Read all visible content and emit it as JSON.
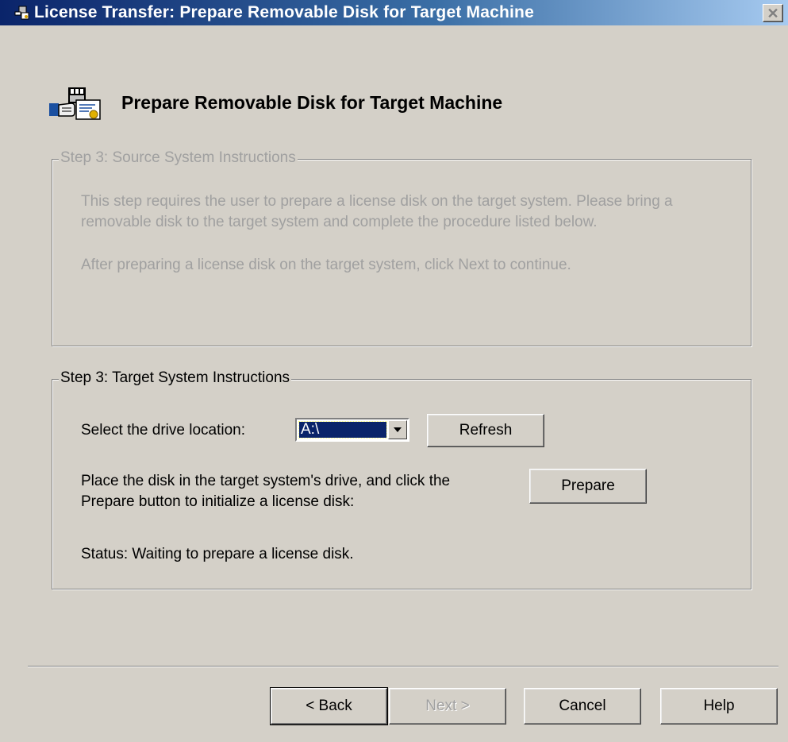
{
  "window": {
    "title": "License Transfer: Prepare Removable Disk for Target Machine",
    "close_glyph": "✕"
  },
  "header": {
    "title": "Prepare Removable Disk for Target Machine",
    "icon": "license-transfer-icon"
  },
  "source_group": {
    "legend": "Step 3: Source System Instructions",
    "paragraph1": "This step requires the user to prepare a license disk on the target system.  Please bring a removable disk to the target system and complete the procedure listed below.",
    "paragraph2": "After preparing a license disk on the target system, click Next to continue.",
    "enabled": false
  },
  "target_group": {
    "legend": "Step 3: Target System Instructions",
    "drive_label": "Select the drive location:",
    "drive_value": "A:\\",
    "refresh_label": "Refresh",
    "prepare_text_line1": "Place the disk in the target system's drive, and click the",
    "prepare_text_line2": "Prepare button to initialize a license disk:",
    "prepare_label": "Prepare",
    "status": "Status: Waiting to prepare a license disk."
  },
  "footer": {
    "back_label": "< Back",
    "next_label": "Next >",
    "cancel_label": "Cancel",
    "help_label": "Help"
  },
  "colors": {
    "dialog_bg": "#d4d0c8",
    "titlebar_start": "#0a246a",
    "titlebar_end": "#a6caf0",
    "selection": "#0a246a",
    "disabled_text": "#a0a0a0"
  }
}
